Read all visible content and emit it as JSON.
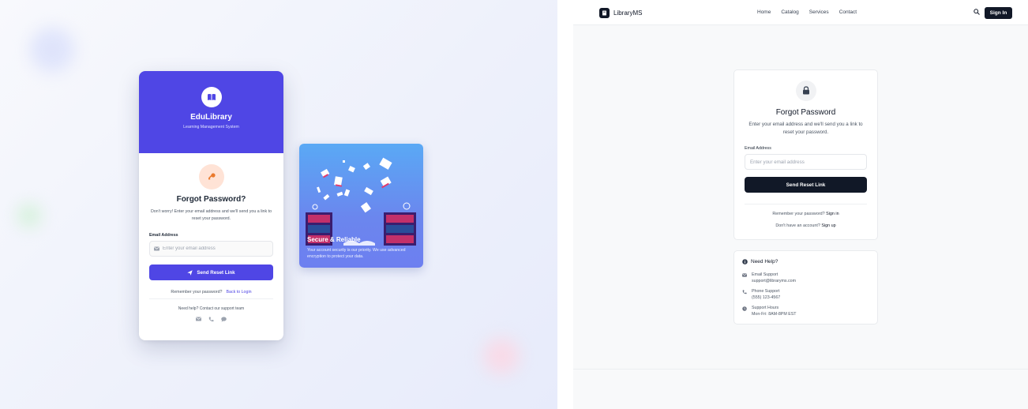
{
  "edulibrary": {
    "app_name": "EduLibrary",
    "app_subtitle": "Learning Management System",
    "heading": "Forgot Password?",
    "description": "Don't worry! Enter your email address and we'll send you a link to reset your password.",
    "email_label": "Email Address",
    "email_placeholder": "Enter your email address",
    "submit_label": "Send Reset Link",
    "remember_text": "Remember your password?",
    "back_to_login": "Back to Login",
    "help_text": "Need help? Contact our support team",
    "colors": {
      "primary": "#4f46e5",
      "accent": "#ffe3d6"
    },
    "icons": [
      "book-icon",
      "key-icon",
      "envelope-icon",
      "paper-plane-icon",
      "phone-icon",
      "chat-icon"
    ]
  },
  "promo": {
    "title": "Secure & Reliable",
    "text": "Your account security is our priority. We use advanced encryption to protect your data."
  },
  "libraryms": {
    "brand": "LibraryMS",
    "nav": [
      "Home",
      "Catalog",
      "Services",
      "Contact"
    ],
    "signin_button": "Sign In",
    "heading": "Forgot Password",
    "description": "Enter your email address and we'll send you a link to reset your password.",
    "email_label": "Email Address",
    "email_placeholder": "Enter your email address",
    "submit_label": "Send Reset Link",
    "remember_text": "Remember your password?",
    "signin_link": "Sign in",
    "no_account_text": "Don't have an account?",
    "signup_link": "Sign up",
    "help": {
      "title": "Need Help?",
      "email_label": "Email Support",
      "email_value": "support@libraryms.com",
      "phone_label": "Phone Support",
      "phone_value": "(555) 123-4567",
      "hours_label": "Support Hours",
      "hours_value": "Mon-Fri: 8AM-8PM EST"
    },
    "colors": {
      "primary": "#111827"
    }
  }
}
